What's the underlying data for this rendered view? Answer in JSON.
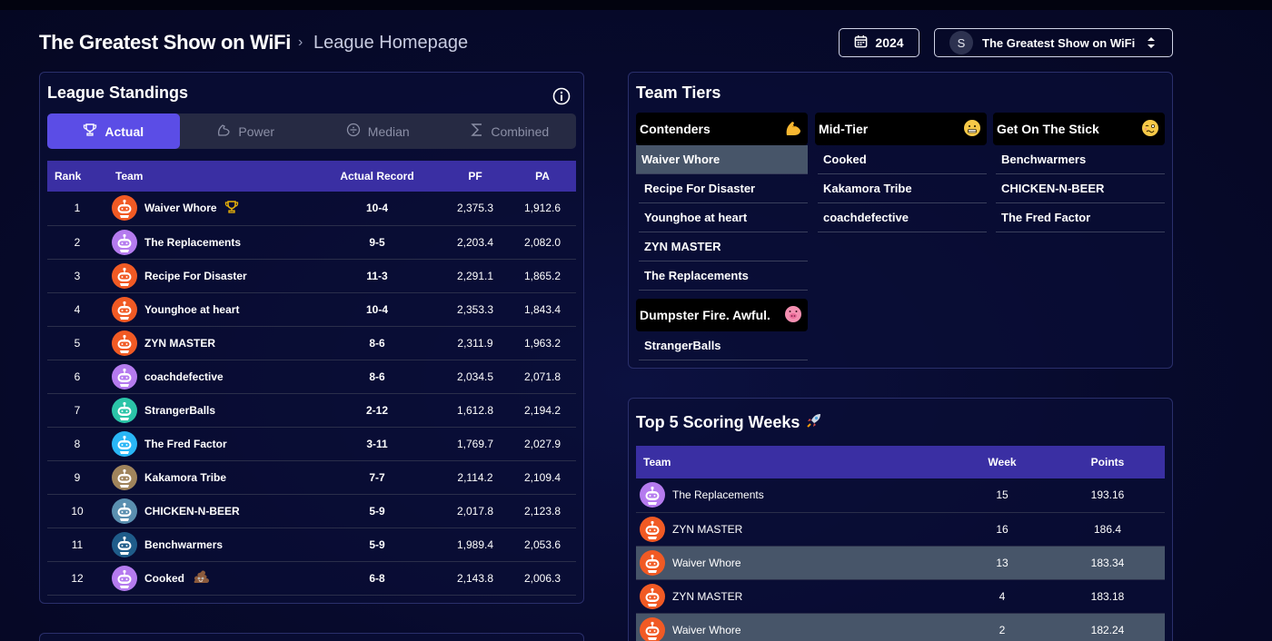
{
  "header": {
    "title": "The Greatest Show on WiFi",
    "crumb_sep": "›",
    "breadcrumb": "League Homepage",
    "year": "2024",
    "league_initial": "S",
    "league_name": "The Greatest Show on WiFi"
  },
  "standings": {
    "title": "League Standings",
    "tabs": [
      {
        "label": "Actual",
        "icon": "trophy-icon"
      },
      {
        "label": "Power",
        "icon": "flex-icon"
      },
      {
        "label": "Median",
        "icon": "median-icon"
      },
      {
        "label": "Combined",
        "icon": "sigma-icon"
      }
    ],
    "active_tab": "Actual",
    "columns": [
      "Rank",
      "Team",
      "Actual Record",
      "PF",
      "PA"
    ],
    "rows": [
      {
        "rank": "1",
        "team": "Waiver Whore",
        "record": "10-4",
        "pf": "2,375.3",
        "pa": "1,912.6",
        "avatar_color": "#f15a24",
        "badge": "trophy"
      },
      {
        "rank": "2",
        "team": "The Replacements",
        "record": "9-5",
        "pf": "2,203.4",
        "pa": "2,082.0",
        "avatar_color": "#b57bef"
      },
      {
        "rank": "3",
        "team": "Recipe For Disaster",
        "record": "11-3",
        "pf": "2,291.1",
        "pa": "1,865.2",
        "avatar_color": "#f15a24"
      },
      {
        "rank": "4",
        "team": "Younghoe at heart",
        "record": "10-4",
        "pf": "2,353.3",
        "pa": "1,843.4",
        "avatar_color": "#f15a24"
      },
      {
        "rank": "5",
        "team": "ZYN MASTER",
        "record": "8-6",
        "pf": "2,311.9",
        "pa": "1,963.2",
        "avatar_color": "#f15a24"
      },
      {
        "rank": "6",
        "team": "coachdefective",
        "record": "8-6",
        "pf": "2,034.5",
        "pa": "2,071.8",
        "avatar_color": "#b57bef"
      },
      {
        "rank": "7",
        "team": "StrangerBalls",
        "record": "2-12",
        "pf": "1,612.8",
        "pa": "2,194.2",
        "avatar_color": "#2bc4a8"
      },
      {
        "rank": "8",
        "team": "The Fred Factor",
        "record": "3-11",
        "pf": "1,769.7",
        "pa": "2,027.9",
        "avatar_color": "#29b6f6"
      },
      {
        "rank": "9",
        "team": "Kakamora Tribe",
        "record": "7-7",
        "pf": "2,114.2",
        "pa": "2,109.4",
        "avatar_color": "#a0845c"
      },
      {
        "rank": "10",
        "team": "CHICKEN-N-BEER",
        "record": "5-9",
        "pf": "2,017.8",
        "pa": "2,123.8",
        "avatar_color": "#5a8fb0"
      },
      {
        "rank": "11",
        "team": "Benchwarmers",
        "record": "5-9",
        "pf": "1,989.4",
        "pa": "2,053.6",
        "avatar_color": "#1f5c8a"
      },
      {
        "rank": "12",
        "team": "Cooked",
        "record": "6-8",
        "pf": "2,143.8",
        "pa": "2,006.3",
        "avatar_color": "#b57bef",
        "badge": "poop"
      }
    ]
  },
  "tiers": {
    "title": "Team Tiers",
    "groups": [
      {
        "name": "Contenders",
        "emoji": "flexed-biceps",
        "teams": [
          "Waiver Whore",
          "Recipe For Disaster",
          "Younghoe at heart",
          "ZYN MASTER",
          "The Replacements"
        ],
        "highlight": "Waiver Whore"
      },
      {
        "name": "Mid-Tier",
        "emoji": "grimacing-face",
        "teams": [
          "Cooked",
          "Kakamora Tribe",
          "coachdefective"
        ]
      },
      {
        "name": "Get On The Stick",
        "emoji": "woozy-face",
        "teams": [
          "Benchwarmers",
          "CHICKEN-N-BEER",
          "The Fred Factor"
        ]
      },
      {
        "name": "Dumpster Fire. Awful.",
        "emoji": "pig-face",
        "teams": [
          "StrangerBalls"
        ]
      }
    ]
  },
  "top5": {
    "title": "Top 5 Scoring Weeks",
    "title_icon": "rocket",
    "columns": [
      "Team",
      "Week",
      "Points"
    ],
    "rows": [
      {
        "team": "The Replacements",
        "week": "15",
        "points": "193.16",
        "avatar_color": "#b57bef",
        "highlight": false
      },
      {
        "team": "ZYN MASTER",
        "week": "16",
        "points": "186.4",
        "avatar_color": "#f15a24",
        "highlight": false
      },
      {
        "team": "Waiver Whore",
        "week": "13",
        "points": "183.34",
        "avatar_color": "#f15a24",
        "highlight": true
      },
      {
        "team": "ZYN MASTER",
        "week": "4",
        "points": "183.18",
        "avatar_color": "#f15a24",
        "highlight": false
      },
      {
        "team": "Waiver Whore",
        "week": "2",
        "points": "182.24",
        "avatar_color": "#f15a24",
        "highlight": true
      }
    ]
  },
  "colors": {
    "accent": "#5b4de6",
    "table_header": "#3a2fa3",
    "highlight_row": "#475569"
  }
}
